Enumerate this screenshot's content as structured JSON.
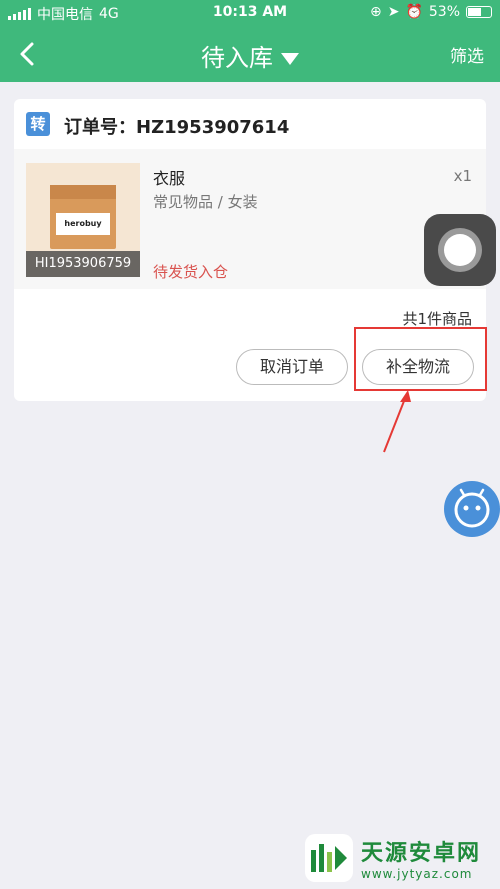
{
  "status_bar": {
    "carrier": "中国电信",
    "network": "4G",
    "time": "10:13 AM",
    "battery": "53%",
    "battery_level": 0.53
  },
  "nav": {
    "title": "待入库",
    "filter_label": "筛选"
  },
  "order": {
    "badge": "转",
    "number_label": "订单号：HZ1953907614",
    "item": {
      "name": "衣服",
      "category": "常见物品 / 女装",
      "quantity": "x1",
      "image_code": "HI1953906759",
      "package_brand": "herobuy",
      "status": "待发货入仓"
    },
    "total": "共1件商品",
    "actions": {
      "cancel": "取消订单",
      "complete_logistics": "补全物流"
    }
  },
  "watermark": {
    "title": "天源安卓网",
    "url": "www.jytyaz.com"
  },
  "colors": {
    "header": "#3fb97c",
    "status_red": "#d9534f",
    "highlight": "#e53935",
    "bot_blue": "#4a90d9"
  }
}
